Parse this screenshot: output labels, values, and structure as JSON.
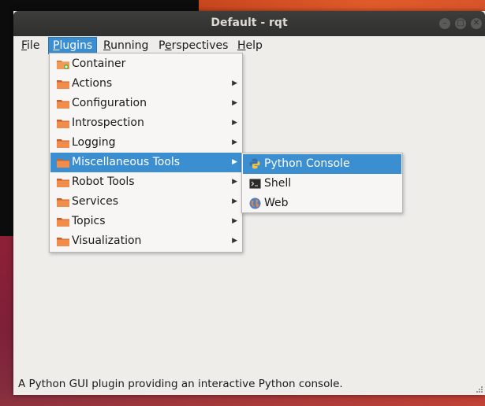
{
  "window": {
    "title": "Default - rqt"
  },
  "menubar": [
    {
      "key": "file",
      "pre": "",
      "u": "F",
      "post": "ile"
    },
    {
      "key": "plugins",
      "pre": "",
      "u": "P",
      "post": "lugins"
    },
    {
      "key": "running",
      "pre": "",
      "u": "R",
      "post": "unning"
    },
    {
      "key": "perspectives",
      "pre": "P",
      "u": "e",
      "post": "rspectives"
    },
    {
      "key": "help",
      "pre": "",
      "u": "H",
      "post": "elp"
    }
  ],
  "plugins_menu": {
    "items": [
      {
        "label": "Container",
        "submenu": false,
        "icon": "container-icon"
      },
      {
        "label": "Actions",
        "submenu": true,
        "icon": "folder-icon"
      },
      {
        "label": "Configuration",
        "submenu": true,
        "icon": "folder-icon"
      },
      {
        "label": "Introspection",
        "submenu": true,
        "icon": "folder-icon"
      },
      {
        "label": "Logging",
        "submenu": true,
        "icon": "folder-icon"
      },
      {
        "label": "Miscellaneous Tools",
        "submenu": true,
        "icon": "folder-icon"
      },
      {
        "label": "Robot Tools",
        "submenu": true,
        "icon": "folder-icon"
      },
      {
        "label": "Services",
        "submenu": true,
        "icon": "folder-icon"
      },
      {
        "label": "Topics",
        "submenu": true,
        "icon": "folder-icon"
      },
      {
        "label": "Visualization",
        "submenu": true,
        "icon": "folder-icon"
      }
    ]
  },
  "misc_tools_menu": {
    "items": [
      {
        "label": "Python Console",
        "icon": "python-icon"
      },
      {
        "label": "Shell",
        "icon": "terminal-icon"
      },
      {
        "label": "Web",
        "icon": "globe-icon"
      }
    ]
  },
  "statusbar": {
    "text": "A Python GUI plugin providing an interactive Python console."
  },
  "colors": {
    "highlight": "#3b8fd1",
    "titlebar": "#2f2f2e",
    "window_bg": "#efedea",
    "folder": "#e07a3a"
  }
}
